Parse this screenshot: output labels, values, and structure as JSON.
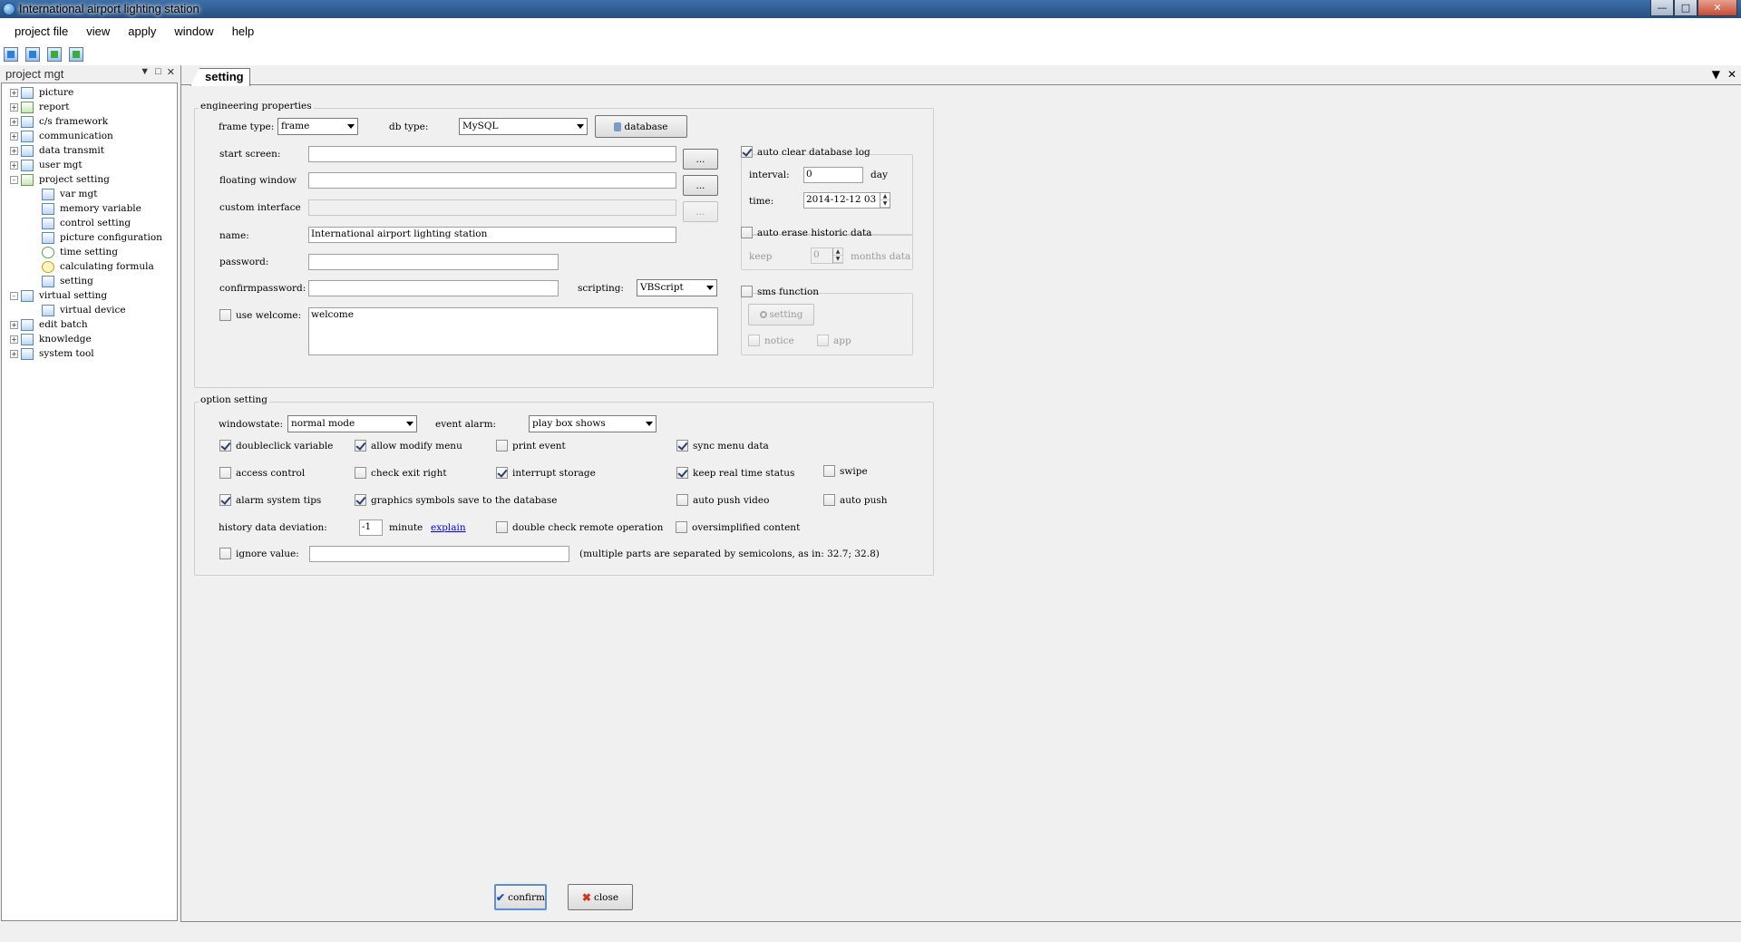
{
  "window": {
    "title": "International airport lighting station"
  },
  "menu": [
    "project file",
    "view",
    "apply",
    "window",
    "help"
  ],
  "project_panel": {
    "title": "project mgt",
    "tree": [
      {
        "label": "picture",
        "level": 0,
        "expander": "+",
        "icon": "picture-icon"
      },
      {
        "label": "report",
        "level": 0,
        "expander": "+",
        "icon": "report-icon"
      },
      {
        "label": "c/s framework",
        "level": 0,
        "expander": "+",
        "icon": "framework-icon"
      },
      {
        "label": "communication",
        "level": 0,
        "expander": "+",
        "icon": "communication-icon"
      },
      {
        "label": "data transmit",
        "level": 0,
        "expander": "+",
        "icon": "data-transmit-icon"
      },
      {
        "label": "user mgt",
        "level": 0,
        "expander": "+",
        "icon": "user-icon"
      },
      {
        "label": "project setting",
        "level": 0,
        "expander": "-",
        "icon": "project-setting-icon"
      },
      {
        "label": "var mgt",
        "level": 1,
        "icon": "var-icon"
      },
      {
        "label": "memory variable",
        "level": 1,
        "icon": "memory-icon"
      },
      {
        "label": "control setting",
        "level": 1,
        "icon": "control-icon"
      },
      {
        "label": "picture configuration",
        "level": 1,
        "icon": "picture-config-icon"
      },
      {
        "label": "time setting",
        "level": 1,
        "icon": "clock-icon"
      },
      {
        "label": "calculating formula",
        "level": 1,
        "icon": "formula-icon"
      },
      {
        "label": "setting",
        "level": 1,
        "icon": "setting-icon"
      },
      {
        "label": "virtual setting",
        "level": 0,
        "expander": "-",
        "icon": "virtual-icon"
      },
      {
        "label": "virtual device",
        "level": 1,
        "icon": "device-icon"
      },
      {
        "label": "edit batch",
        "level": 0,
        "expander": "+",
        "icon": "batch-icon"
      },
      {
        "label": "knowledge",
        "level": 0,
        "expander": "+",
        "icon": "knowledge-icon"
      },
      {
        "label": "system tool",
        "level": 0,
        "expander": "+",
        "icon": "tool-icon"
      }
    ]
  },
  "tab": {
    "label": "setting"
  },
  "engineering": {
    "legend": "engineering properties",
    "frame_type_label": "frame type:",
    "frame_type_value": "frame",
    "db_type_label": "db type:",
    "db_type_value": "MySQL",
    "database_button": "database",
    "start_screen_label": "start screen:",
    "floating_window_label": "floating window",
    "custom_interface_label": "custom interface",
    "browse_button": "...",
    "name_label": "name:",
    "name_value": "International airport lighting station",
    "password_label": "password:",
    "confirm_password_label": "confirmpassword:",
    "scripting_label": "scripting:",
    "scripting_value": "VBScript",
    "use_welcome_label": "use welcome:",
    "welcome_text": "welcome",
    "auto_clear_label": "auto clear database log",
    "interval_label": "interval:",
    "interval_value": "0",
    "interval_unit": "day",
    "time_label": "time:",
    "time_value": "2014-12-12 03",
    "auto_erase_label": "auto erase historic data",
    "keep_label": "keep",
    "keep_value": "0",
    "keep_unit": "months data",
    "sms_label": "sms function",
    "sms_setting_button": "setting",
    "notice_label": "notice",
    "app_label": "app"
  },
  "options": {
    "legend": "option setting",
    "windowstate_label": "windowstate:",
    "windowstate_value": "normal mode",
    "event_alarm_label": "event alarm:",
    "event_alarm_value": "play box shows",
    "doubleclick_variable": "doubleclick variable",
    "allow_modify_menu": "allow modify menu",
    "print_event": "print event",
    "sync_menu_data": "sync menu data",
    "access_control": "access control",
    "check_exit_right": "check exit right",
    "interrupt_storage": "interrupt storage",
    "keep_real_time_status": "keep real time status",
    "swipe": "swipe",
    "alarm_system_tips": "alarm system tips",
    "graphics_symbols": "graphics symbols save to the database",
    "auto_push_video": "auto push video",
    "auto_push": "auto push",
    "history_deviation_label": "history data deviation:",
    "history_deviation_value": "-1",
    "minute_label": "minute",
    "explain_link": "explain",
    "double_check_remote": "double check remote operation",
    "oversimplified_content": "oversimplified content",
    "ignore_value_label": "ignore value:",
    "ignore_value_hint": "(multiple parts are separated by semicolons, as in: 32.7; 32.8)"
  },
  "footer": {
    "confirm_button": "confirm",
    "close_button": "close"
  }
}
